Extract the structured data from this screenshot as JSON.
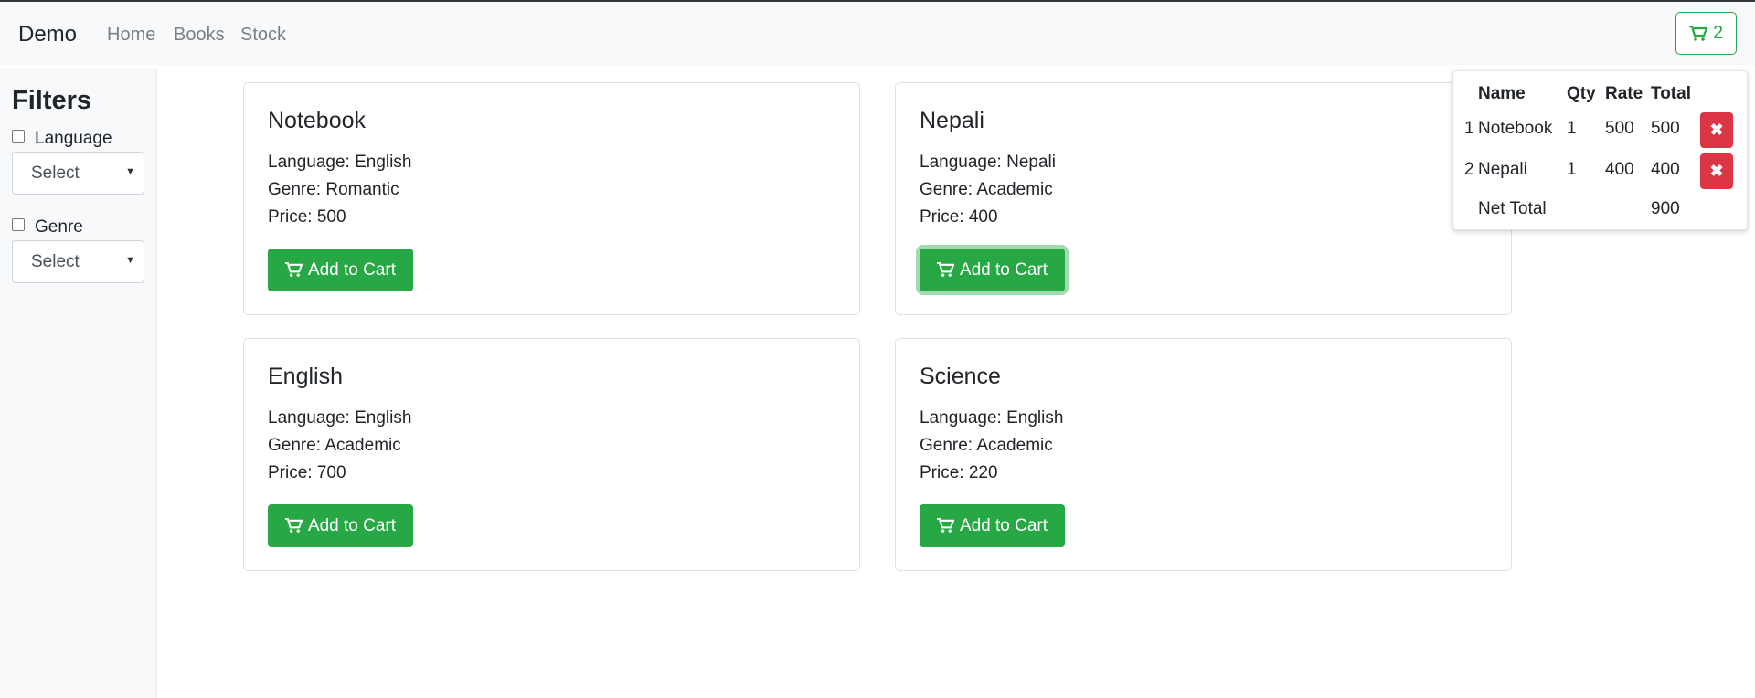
{
  "navbar": {
    "brand": "Demo",
    "links": [
      "Home",
      "Books",
      "Stock"
    ],
    "cart_count": "2"
  },
  "filters": {
    "title": "Filters",
    "language_label": "Language",
    "language_select": "Select",
    "genre_label": "Genre",
    "genre_select": "Select"
  },
  "books": [
    {
      "title": "Notebook",
      "language": "Language: English",
      "genre": "Genre: Romantic",
      "price": "Price: 500",
      "button": "Add to Cart"
    },
    {
      "title": "Nepali",
      "language": "Language: Nepali",
      "genre": "Genre: Academic",
      "price": "Price: 400",
      "button": "Add to Cart"
    },
    {
      "title": "English",
      "language": "Language: English",
      "genre": "Genre: Academic",
      "price": "Price: 700",
      "button": "Add to Cart"
    },
    {
      "title": "Science",
      "language": "Language: English",
      "genre": "Genre: Academic",
      "price": "Price: 220",
      "button": "Add to Cart"
    }
  ],
  "cart": {
    "headers": {
      "name": "Name",
      "qty": "Qty",
      "rate": "Rate",
      "total": "Total"
    },
    "items": [
      {
        "index": "1",
        "name": "Notebook",
        "qty": "1",
        "rate": "500",
        "total": "500"
      },
      {
        "index": "2",
        "name": "Nepali",
        "qty": "1",
        "rate": "400",
        "total": "400"
      }
    ],
    "net_label": "Net Total",
    "net_total": "900"
  },
  "colors": {
    "success": "#28a745",
    "danger": "#dc3545"
  },
  "icons": {
    "cart": "cart-icon",
    "remove": "times-icon",
    "caret": "caret-down-icon"
  }
}
